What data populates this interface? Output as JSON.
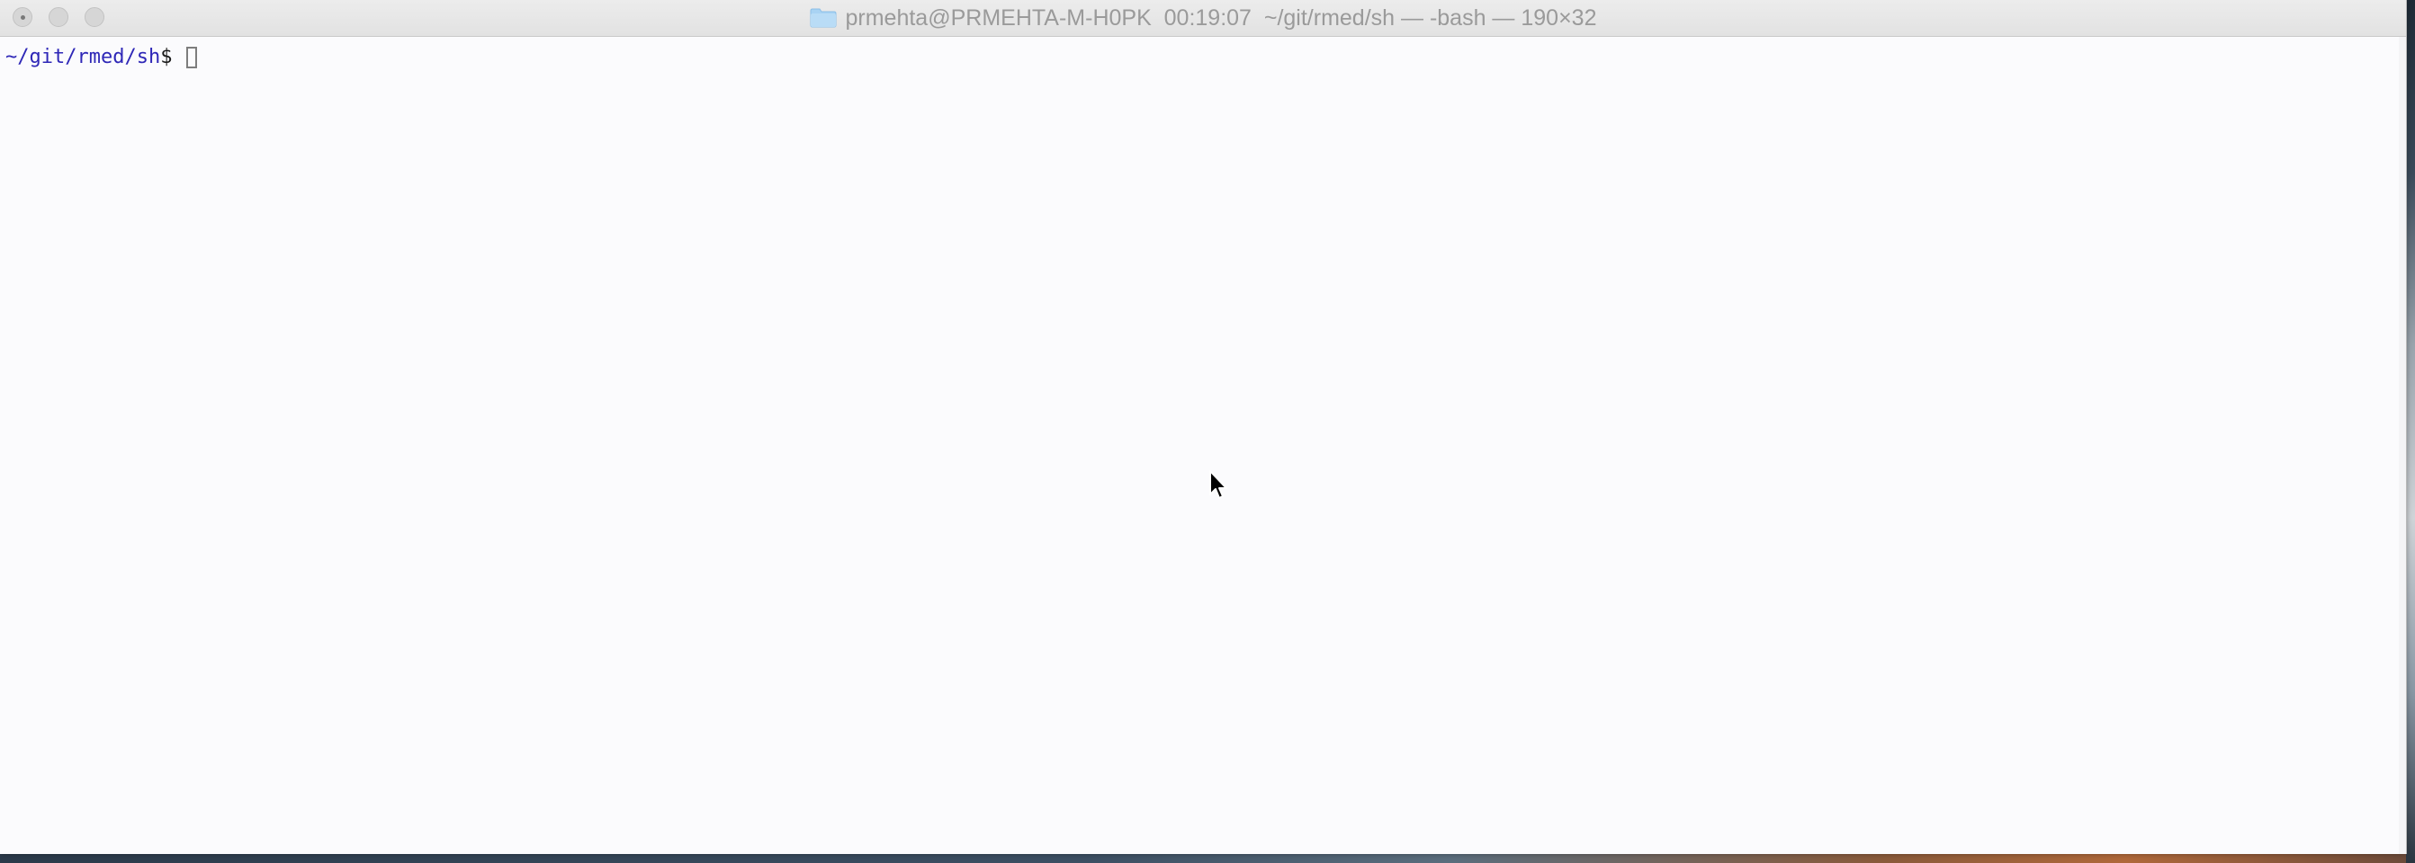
{
  "window": {
    "title": "prmehta@PRMEHTA-M-H0PK  00:19:07  ~/git/rmed/sh — -bash — 190×32",
    "title_icon": "folder-icon",
    "buttons": [
      "close",
      "minimize",
      "zoom"
    ]
  },
  "terminal": {
    "prompt_path": "~/git/rmed/sh",
    "prompt_symbol": "$",
    "input_value": "",
    "colors": {
      "path": "#2e27b7",
      "text": "#1a1a1a",
      "background": "#fbfbfd"
    }
  },
  "pointer": {
    "icon": "mouse-pointer-icon"
  }
}
